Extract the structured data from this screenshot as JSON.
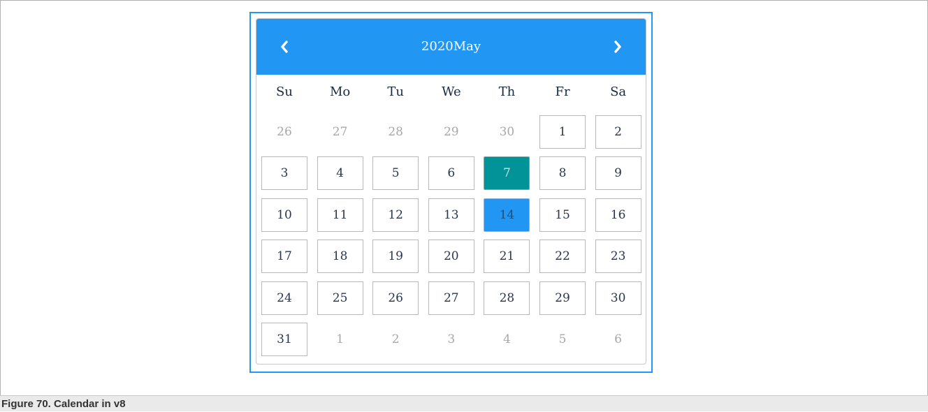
{
  "calendar": {
    "title": "2020May",
    "day_names": [
      "Su",
      "Mo",
      "Tu",
      "We",
      "Th",
      "Fr",
      "Sa"
    ],
    "weeks": [
      [
        {
          "d": "26",
          "m": "prev"
        },
        {
          "d": "27",
          "m": "prev"
        },
        {
          "d": "28",
          "m": "prev"
        },
        {
          "d": "29",
          "m": "prev"
        },
        {
          "d": "30",
          "m": "prev"
        },
        {
          "d": "1",
          "m": "cur"
        },
        {
          "d": "2",
          "m": "cur"
        }
      ],
      [
        {
          "d": "3",
          "m": "cur"
        },
        {
          "d": "4",
          "m": "cur"
        },
        {
          "d": "5",
          "m": "cur"
        },
        {
          "d": "6",
          "m": "cur"
        },
        {
          "d": "7",
          "m": "cur",
          "state": "today"
        },
        {
          "d": "8",
          "m": "cur"
        },
        {
          "d": "9",
          "m": "cur"
        }
      ],
      [
        {
          "d": "10",
          "m": "cur"
        },
        {
          "d": "11",
          "m": "cur"
        },
        {
          "d": "12",
          "m": "cur"
        },
        {
          "d": "13",
          "m": "cur"
        },
        {
          "d": "14",
          "m": "cur",
          "state": "selected"
        },
        {
          "d": "15",
          "m": "cur"
        },
        {
          "d": "16",
          "m": "cur"
        }
      ],
      [
        {
          "d": "17",
          "m": "cur"
        },
        {
          "d": "18",
          "m": "cur"
        },
        {
          "d": "19",
          "m": "cur"
        },
        {
          "d": "20",
          "m": "cur"
        },
        {
          "d": "21",
          "m": "cur"
        },
        {
          "d": "22",
          "m": "cur"
        },
        {
          "d": "23",
          "m": "cur"
        }
      ],
      [
        {
          "d": "24",
          "m": "cur"
        },
        {
          "d": "25",
          "m": "cur"
        },
        {
          "d": "26",
          "m": "cur"
        },
        {
          "d": "27",
          "m": "cur"
        },
        {
          "d": "28",
          "m": "cur"
        },
        {
          "d": "29",
          "m": "cur"
        },
        {
          "d": "30",
          "m": "cur"
        }
      ],
      [
        {
          "d": "31",
          "m": "cur"
        },
        {
          "d": "1",
          "m": "next"
        },
        {
          "d": "2",
          "m": "next"
        },
        {
          "d": "3",
          "m": "next"
        },
        {
          "d": "4",
          "m": "next"
        },
        {
          "d": "5",
          "m": "next"
        },
        {
          "d": "6",
          "m": "next"
        }
      ]
    ]
  },
  "icons": {
    "prev": "chevron-left-icon",
    "next": "chevron-right-icon"
  },
  "colors": {
    "header": "#2196f3",
    "today": "#009499",
    "selected": "#2196f3",
    "outline": "#2196f3"
  },
  "caption": "Figure 70.  Calendar in v8"
}
